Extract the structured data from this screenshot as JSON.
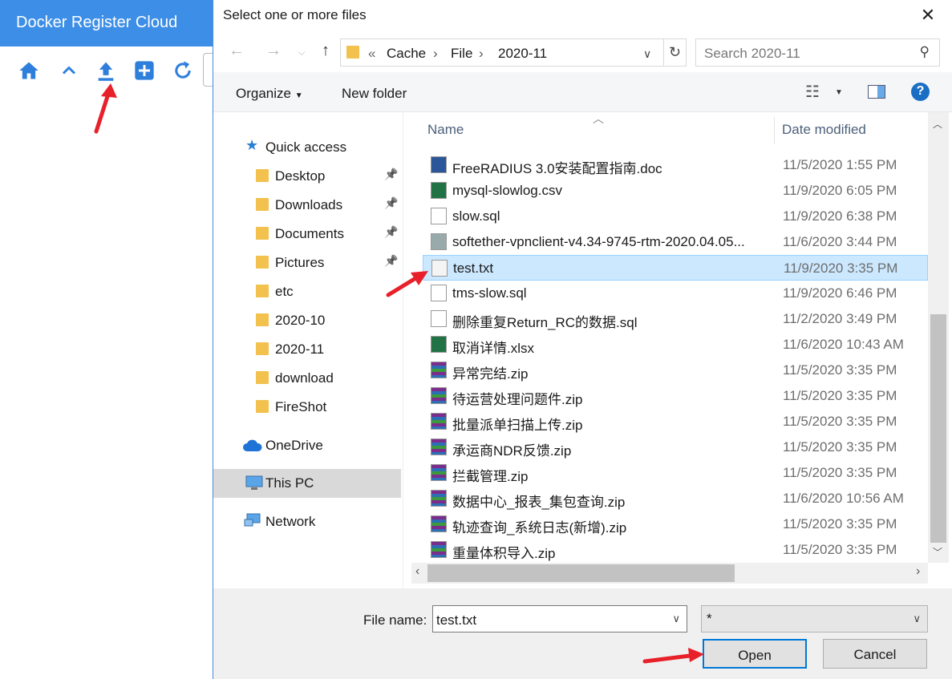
{
  "app": {
    "title": "Docker Register Cloud"
  },
  "dialog": {
    "title": "Select one or more files",
    "breadcrumb": {
      "overflow": "«",
      "parts": [
        "Cache",
        "File",
        "2020-11"
      ]
    },
    "search_placeholder": "Search 2020-11",
    "toolbar": {
      "organize": "Organize",
      "new_folder": "New folder"
    },
    "nav": {
      "quick_access": "Quick access",
      "items": [
        {
          "label": "Desktop",
          "pinned": true
        },
        {
          "label": "Downloads",
          "pinned": true
        },
        {
          "label": "Documents",
          "pinned": true
        },
        {
          "label": "Pictures",
          "pinned": true
        },
        {
          "label": "etc",
          "pinned": false
        },
        {
          "label": "2020-10",
          "pinned": false
        },
        {
          "label": "2020-11",
          "pinned": false
        },
        {
          "label": "download",
          "pinned": false
        },
        {
          "label": "FireShot",
          "pinned": false
        }
      ],
      "onedrive": "OneDrive",
      "this_pc": "This PC",
      "network": "Network"
    },
    "columns": {
      "name": "Name",
      "date": "Date modified"
    },
    "files": [
      {
        "name": "FreeRADIUS 3.0安装配置指南.doc",
        "date": "11/5/2020 1:55 PM",
        "icon": "word-icon"
      },
      {
        "name": "mysql-slowlog.csv",
        "date": "11/9/2020 6:05 PM",
        "icon": "excel-icon"
      },
      {
        "name": "slow.sql",
        "date": "11/9/2020 6:38 PM",
        "icon": "file-icon"
      },
      {
        "name": "softether-vpnclient-v4.34-9745-rtm-2020.04.05...",
        "date": "11/6/2020 3:44 PM",
        "icon": "installer-icon"
      },
      {
        "name": "test.txt",
        "date": "11/9/2020 3:35 PM",
        "icon": "text-file-icon"
      },
      {
        "name": "tms-slow.sql",
        "date": "11/9/2020 6:46 PM",
        "icon": "file-icon"
      },
      {
        "name": "删除重复Return_RC的数据.sql",
        "date": "11/2/2020 3:49 PM",
        "icon": "file-icon"
      },
      {
        "name": "取消详情.xlsx",
        "date": "11/6/2020 10:43 AM",
        "icon": "excel-icon"
      },
      {
        "name": "异常完结.zip",
        "date": "11/5/2020 3:35 PM",
        "icon": "archive-icon"
      },
      {
        "name": "待运营处理问题件.zip",
        "date": "11/5/2020 3:35 PM",
        "icon": "archive-icon"
      },
      {
        "name": "批量派单扫描上传.zip",
        "date": "11/5/2020 3:35 PM",
        "icon": "archive-icon"
      },
      {
        "name": "承运商NDR反馈.zip",
        "date": "11/5/2020 3:35 PM",
        "icon": "archive-icon"
      },
      {
        "name": "拦截管理.zip",
        "date": "11/5/2020 3:35 PM",
        "icon": "archive-icon"
      },
      {
        "name": "数据中心_报表_集包查询.zip",
        "date": "11/6/2020 10:56 AM",
        "icon": "archive-icon"
      },
      {
        "name": "轨迹查询_系统日志(新增).zip",
        "date": "11/5/2020 3:35 PM",
        "icon": "archive-icon"
      },
      {
        "name": "重量体积导入.zip",
        "date": "11/5/2020 3:35 PM",
        "icon": "archive-icon"
      }
    ],
    "selected_file": "test.txt",
    "file_name_label": "File name:",
    "file_name_value": "test.txt",
    "file_type": "*",
    "open_label": "Open",
    "cancel_label": "Cancel",
    "colors": {
      "accent": "#0078d7",
      "selected_row": "#cce8ff",
      "annotation": "#e8202a"
    }
  }
}
